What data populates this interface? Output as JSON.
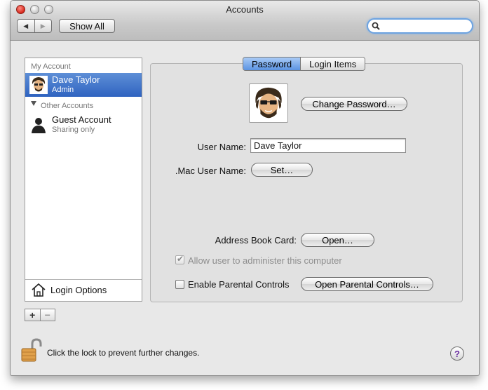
{
  "window": {
    "title": "Accounts"
  },
  "toolbar": {
    "back_icon": "back-arrow-icon",
    "forward_icon": "forward-arrow-icon",
    "show_all_label": "Show All",
    "search_placeholder": "",
    "search_value": ""
  },
  "sidebar": {
    "my_account_header": "My Account",
    "current_user": {
      "name": "Dave Taylor",
      "role": "Admin"
    },
    "other_accounts_header": "Other Accounts",
    "guest": {
      "name": "Guest Account",
      "sub": "Sharing only"
    },
    "login_options_label": "Login Options",
    "add_label": "+",
    "remove_label": "−"
  },
  "tabs": [
    {
      "label": "Password",
      "active": true
    },
    {
      "label": "Login Items",
      "active": false
    }
  ],
  "password_pane": {
    "change_password_label": "Change Password…",
    "user_name_label": "User Name:",
    "user_name_value": "Dave Taylor",
    "mac_user_name_label": ".Mac User Name:",
    "set_label": "Set…",
    "address_book_label": "Address Book Card:",
    "open_label": "Open…",
    "allow_admin_label": "Allow user to administer this computer",
    "allow_admin_checked": true,
    "parental_label": "Enable Parental Controls",
    "parental_checked": false,
    "open_parental_label": "Open Parental Controls…"
  },
  "footer": {
    "lock_text": "Click the lock to prevent further changes.",
    "help_label": "?"
  },
  "colors": {
    "selection": "#3468c6",
    "accent": "#5b93e2"
  }
}
